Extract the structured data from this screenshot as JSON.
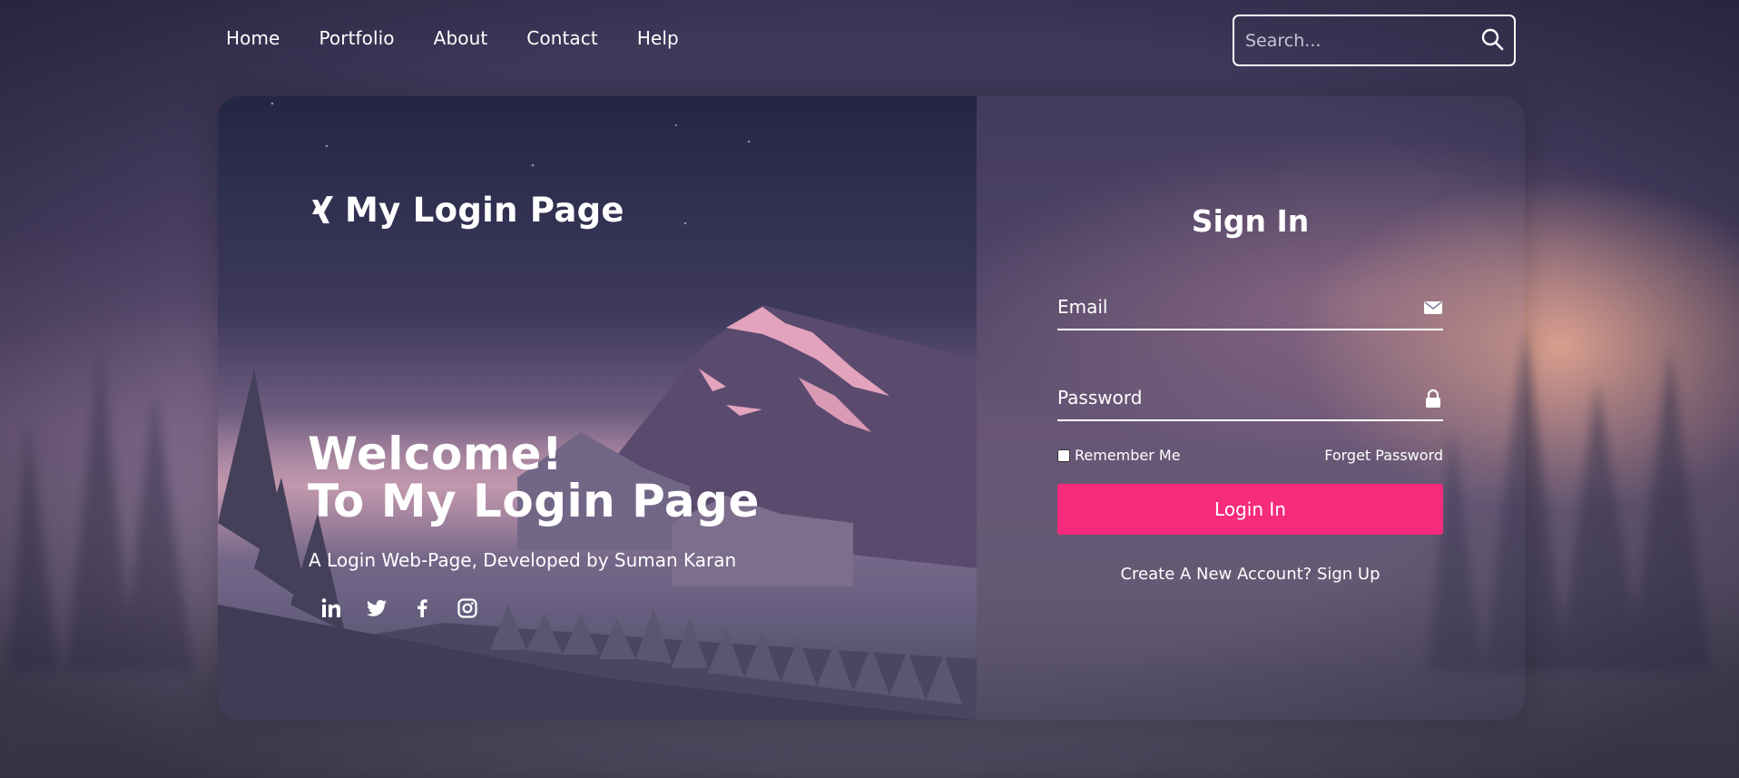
{
  "nav": {
    "links": [
      "Home",
      "Portfolio",
      "About",
      "Contact",
      "Help"
    ],
    "search_placeholder": "Search..."
  },
  "brand": {
    "title": "My Login Page",
    "logo_icon": "xing-icon"
  },
  "hero": {
    "line1": "Welcome!",
    "line2": "To My Login Page",
    "subtitle": "A Login Web-Page, Developed by Suman Karan",
    "socials": [
      "linkedin-icon",
      "twitter-icon",
      "facebook-icon",
      "instagram-icon"
    ]
  },
  "form": {
    "title": "Sign In",
    "email_placeholder": "Email",
    "password_placeholder": "Password",
    "remember_label": "Remember Me",
    "forget_label": "Forget Password",
    "login_label": "Login In",
    "signup_label": "Create A New Account? Sign Up"
  },
  "colors": {
    "accent": "#f72b7b",
    "text": "#ffffff"
  }
}
